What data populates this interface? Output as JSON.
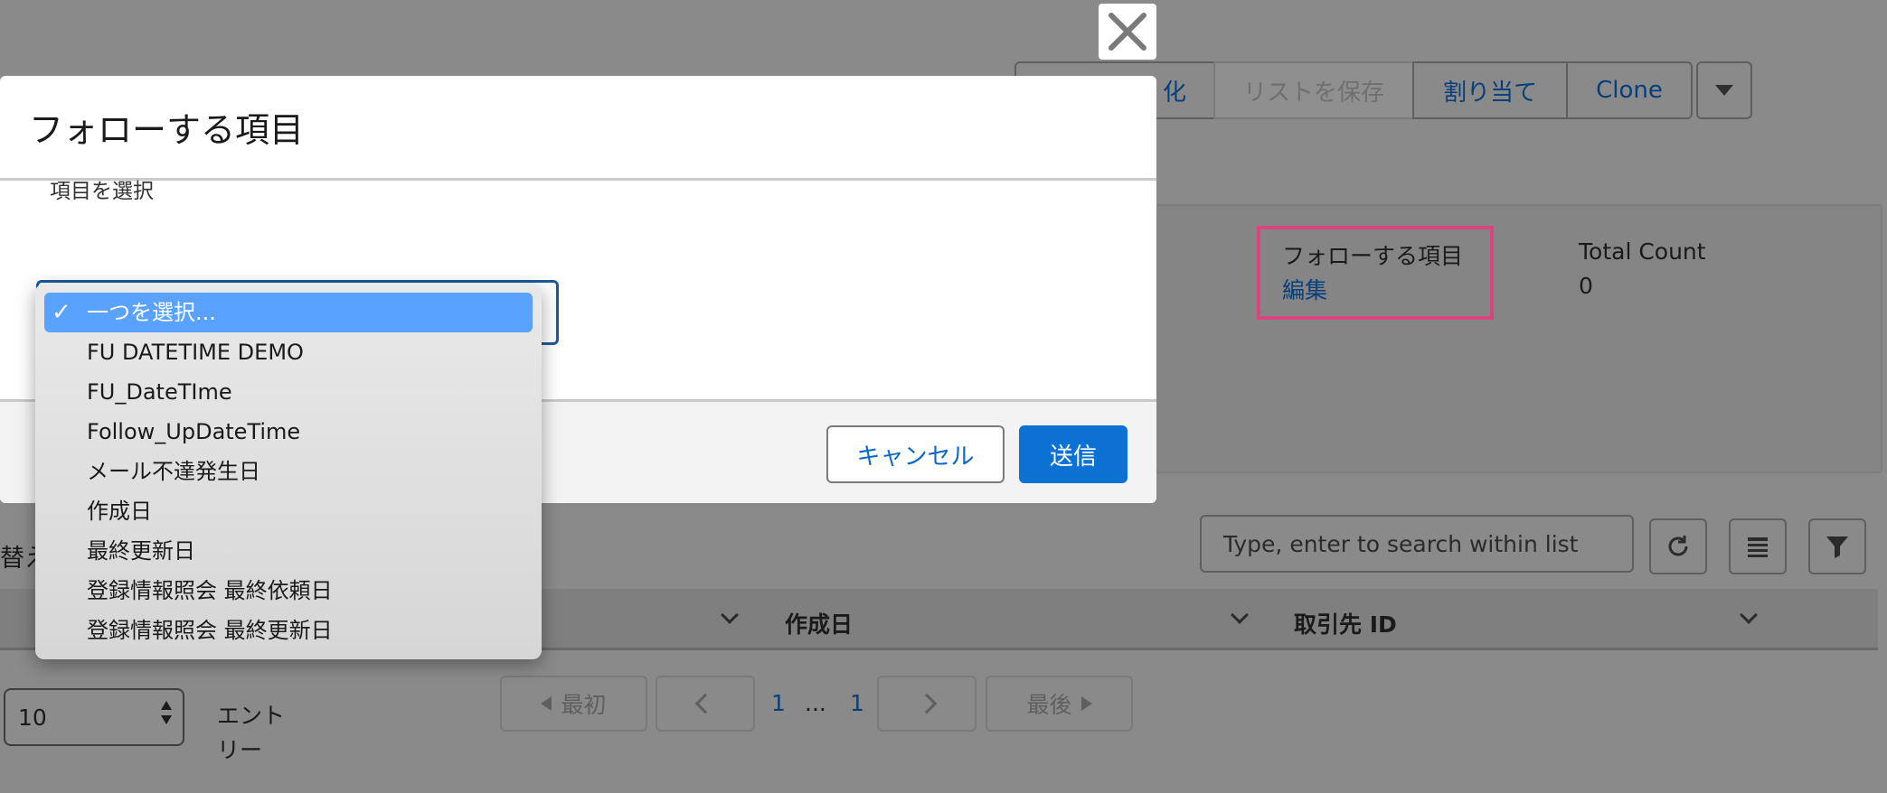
{
  "toolbar": {
    "btn1_label": "化",
    "save_list_label": "リストを保存",
    "assign_label": "割り当て",
    "clone_label": "Clone"
  },
  "panel": {
    "follow_field_label": "フォローする項目",
    "edit_link": "編集",
    "total_count_label": "Total Count",
    "total_count_value": "0"
  },
  "list": {
    "search_placeholder": "Type, enter to search within list",
    "sort_fragment": "替え",
    "columns": [
      "作成日",
      "取引先 ID"
    ]
  },
  "pagination": {
    "per_page_value": "10",
    "entries_label_1": "エント",
    "entries_label_2": "リー",
    "first_label": "最初",
    "last_label": "最後",
    "current_page": "1",
    "ellipsis": "...",
    "total_pages": "1"
  },
  "modal": {
    "title": "フォローする項目",
    "field_label": "項目を選択",
    "cancel_label": "キャンセル",
    "submit_label": "送信",
    "options": [
      "一つを選択...",
      "FU DATETIME DEMO",
      "FU_DateTIme",
      "Follow_UpDateTime",
      "メール不達発生日",
      "作成日",
      "最終更新日",
      "登録情報照会 最終依頼日",
      "登録情報照会 最終更新日"
    ],
    "selected_index": 0
  },
  "colors": {
    "brand_blue": "#0b72d3",
    "link_blue": "#0a68c8",
    "highlight_pink": "#d9467f",
    "option_selected": "#5aa2ff"
  }
}
